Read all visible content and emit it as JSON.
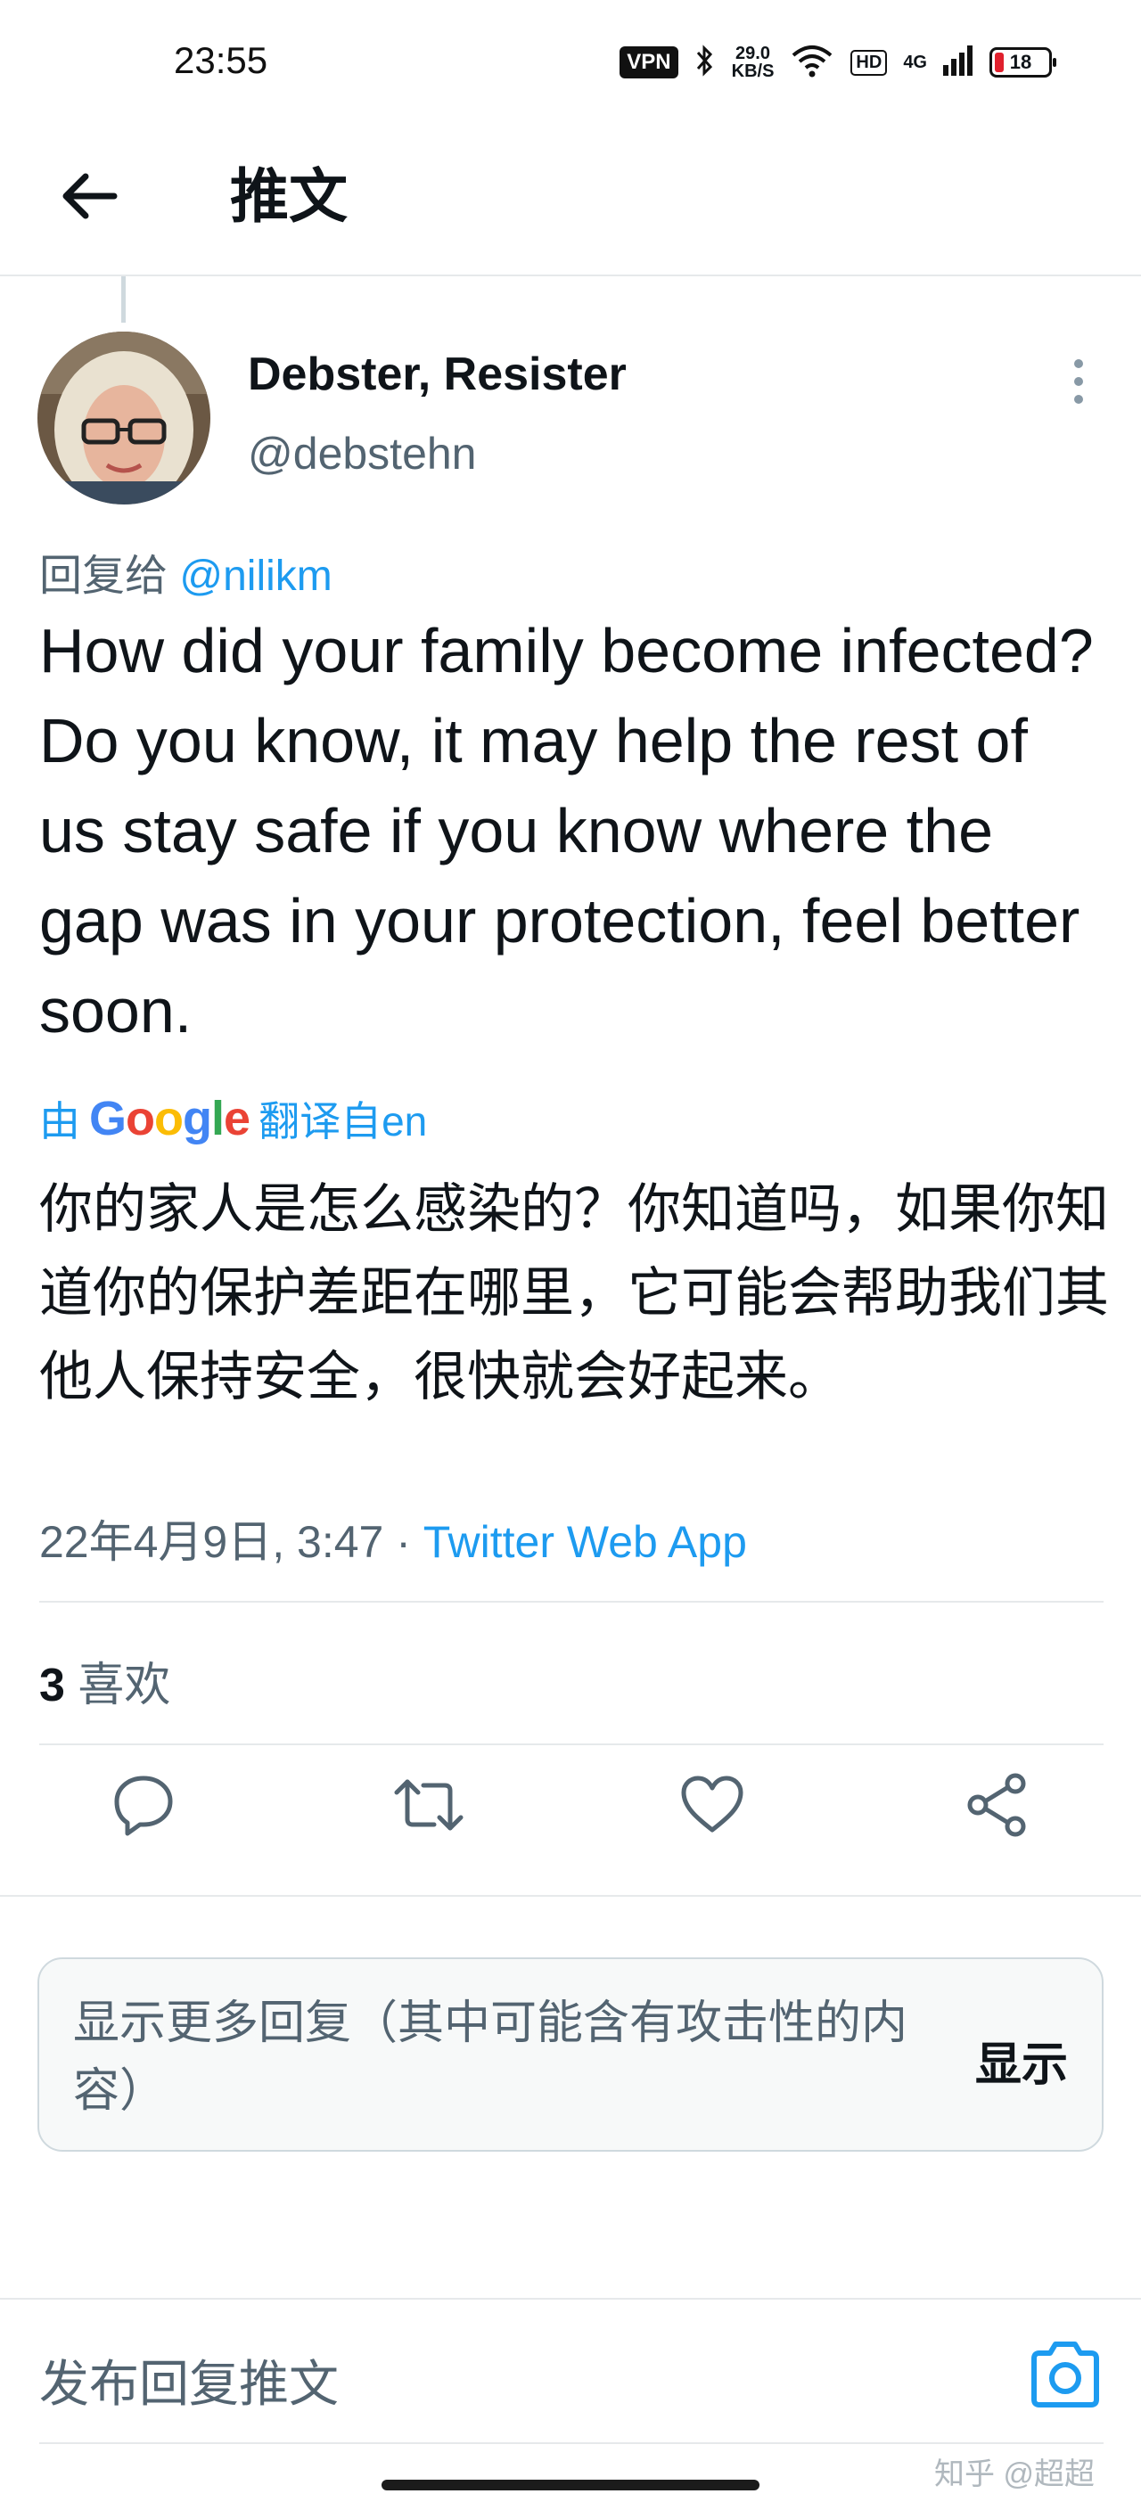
{
  "status_bar": {
    "time": "23:55",
    "vpn": "VPN",
    "speed_value": "29.0",
    "speed_unit": "KB/S",
    "hd": "HD",
    "network": "4G",
    "battery": "18"
  },
  "header": {
    "title": "推文"
  },
  "tweet": {
    "author_name": "Debster, Resister",
    "author_handle": "@debstehn",
    "reply_prefix": "回复给",
    "reply_mention": "@nilikm",
    "text": "How did your family become infected? Do you know, it may help the rest of us stay safe if you know where the gap was in your protection, feel better soon.",
    "translate_prefix": "由",
    "translate_suffix": "翻译自en",
    "translated_text": "你的家人是怎么感染的？你知道吗，如果你知道你的保护差距在哪里，它可能会帮助我们其他人保持安全，很快就会好起来。",
    "timestamp": "22年4月9日, 3:47 · ",
    "source_app": "Twitter Web App",
    "like_count": "3",
    "like_label": " 喜欢"
  },
  "more_replies": {
    "text": "显示更多回复（其中可能含有攻击性的内容）",
    "button": "显示"
  },
  "compose": {
    "placeholder": "发布回复推文"
  },
  "watermark": "知乎 @超超",
  "colors": {
    "accent": "#1d9bf0",
    "text_primary": "#0f1419",
    "text_secondary": "#536471",
    "divider": "#e6e9eb"
  },
  "icons": [
    "back-arrow-icon",
    "more-vertical-icon",
    "reply-icon",
    "retweet-icon",
    "like-icon",
    "share-icon",
    "camera-icon"
  ]
}
